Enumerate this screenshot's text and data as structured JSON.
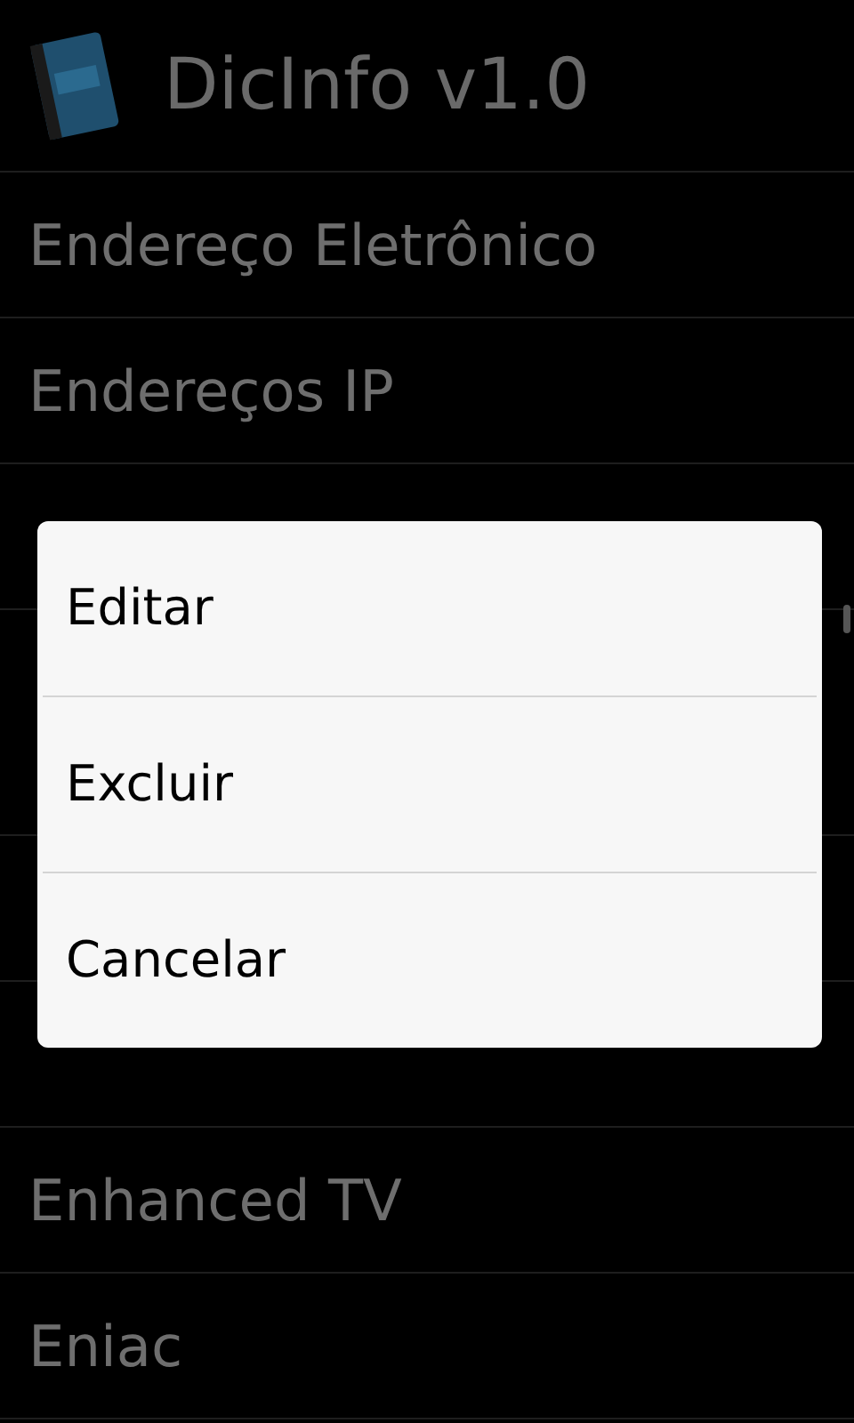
{
  "app_bar": {
    "title": "DicInfo v1.0"
  },
  "list": [
    {
      "text": "Endereço Eletrônico"
    },
    {
      "text": "Endereços IP"
    },
    {
      "kind": "row"
    },
    {
      "kind": "tall"
    },
    {
      "kind": "row"
    },
    {
      "kind": "row"
    },
    {
      "text": "Enhanced TV"
    },
    {
      "text": "Eniac"
    }
  ],
  "dialog": {
    "items": [
      "Editar",
      "Excluir",
      "Cancelar"
    ]
  }
}
